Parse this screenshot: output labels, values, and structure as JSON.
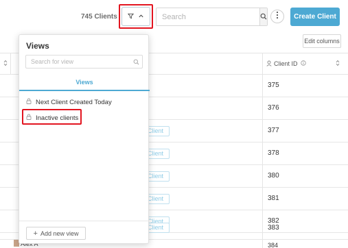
{
  "toolbar": {
    "clients_count": "745 Clients",
    "search_placeholder": "Search",
    "create_button": "Create Client",
    "edit_columns": "Edit columns"
  },
  "table": {
    "client_id_header": "Client ID",
    "rows": [
      {
        "id": "375",
        "tag": ""
      },
      {
        "id": "376",
        "tag": ""
      },
      {
        "id": "377",
        "tag": "Client"
      },
      {
        "id": "378",
        "tag": "Client"
      },
      {
        "id": "380",
        "tag": "Client"
      },
      {
        "id": "381",
        "tag": "Client"
      },
      {
        "id": "382",
        "tag": "Client"
      },
      {
        "id": "383",
        "tag": "Client"
      }
    ],
    "peek_name": "Alex A",
    "peek_id": "384"
  },
  "views_panel": {
    "title": "Views",
    "search_placeholder": "Search for view",
    "tab_label": "Views",
    "items": [
      "Next Client Created Today",
      "Inactive clients"
    ],
    "add_button": "Add new view"
  },
  "colors": {
    "accent": "#4da9d3",
    "highlight": "#e2141f"
  }
}
